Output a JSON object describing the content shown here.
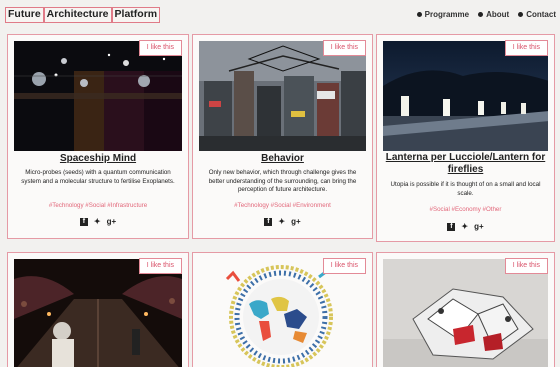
{
  "header": {
    "logo_words": [
      "Future",
      "Architecture",
      "Platform"
    ],
    "nav": [
      "Programme",
      "About",
      "Contact"
    ]
  },
  "cards": [
    {
      "like": "I like this",
      "title": "Spaceship Mind",
      "desc": "Micro-probes (seeds) with a quantum communication system and a molecular structure to fertilise Exoplanets.",
      "tags": "#Technology #Social #Infrastructure",
      "social": [
        "f",
        "✦",
        "g+"
      ]
    },
    {
      "like": "I like this",
      "title": "Behavior",
      "desc": "Only new behavior, which through challenge gives the better understanding of the surrounding, can bring the perception of future architecture.",
      "tags": "#Technology #Social #Environment",
      "social": [
        "f",
        "✦",
        "g+"
      ]
    },
    {
      "like": "I like this",
      "title": "Lanterna per Lucciole/Lantern for fireflies",
      "desc": "Utopia is possible if it is thought of on a small and local scale.",
      "tags": "#Social #Economy #Other",
      "social": [
        "f",
        "✦",
        "g+"
      ]
    },
    {
      "like": "I like this"
    },
    {
      "like": "I like this"
    },
    {
      "like": "I like this"
    }
  ]
}
